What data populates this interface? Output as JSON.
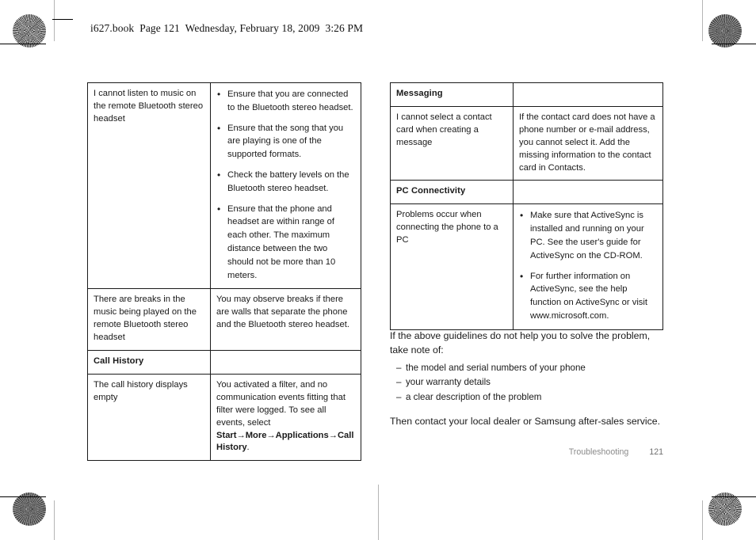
{
  "page": {
    "running_header": "i627.book  Page 121  Wednesday, February 18, 2009  3:26 PM",
    "footer_section": "Troubleshooting",
    "footer_page_number": "121"
  },
  "left_table": {
    "rows": [
      {
        "type": "qa",
        "question": "I cannot listen to music on the remote Bluetooth stereo headset",
        "bullets": [
          "Ensure that you are connected to the Bluetooth stereo headset.",
          "Ensure that the song that you are playing is one of the supported formats.",
          "Check the battery levels on the Bluetooth stereo headset.",
          "Ensure that the phone and headset are within range of each other. The maximum distance between the two should not be more than 10 meters."
        ]
      },
      {
        "type": "qa",
        "question": "There are breaks in the music being played on the remote Bluetooth stereo headset",
        "answer": "You may observe breaks if there are walls that separate the phone and the Bluetooth stereo headset."
      },
      {
        "type": "section",
        "title": "Call History"
      },
      {
        "type": "qa-rich",
        "question": "The call history displays empty",
        "answer_lead": "You activated a filter, and no communication events fitting that filter were logged. To see all events, select ",
        "path": [
          "Start",
          "More",
          "Applications",
          "Call History"
        ],
        "arrow": "→",
        "answer_tail": "."
      }
    ]
  },
  "right_table": {
    "rows": [
      {
        "type": "section",
        "title": "Messaging"
      },
      {
        "type": "qa",
        "question": "I cannot select a contact card when creating a message",
        "answer": "If the contact card does not have a phone number or e-mail address, you cannot select it. Add the missing information to the contact card in Contacts."
      },
      {
        "type": "section",
        "title": "PC Connectivity"
      },
      {
        "type": "qa",
        "question": "Problems occur when connecting the phone to a PC",
        "bullets": [
          "Make sure that ActiveSync is installed and running on your PC. See the user's guide for ActiveSync on the CD-ROM.",
          "For further information on ActiveSync, see the help function on ActiveSync or visit www.microsoft.com."
        ]
      }
    ]
  },
  "closing": {
    "intro": "If the above guidelines do not help you to solve the problem, take note of:",
    "items": [
      "the model and serial numbers of your phone",
      "your warranty details",
      "a clear description of the problem"
    ],
    "outro": "Then contact your local dealer or Samsung after-sales service."
  }
}
